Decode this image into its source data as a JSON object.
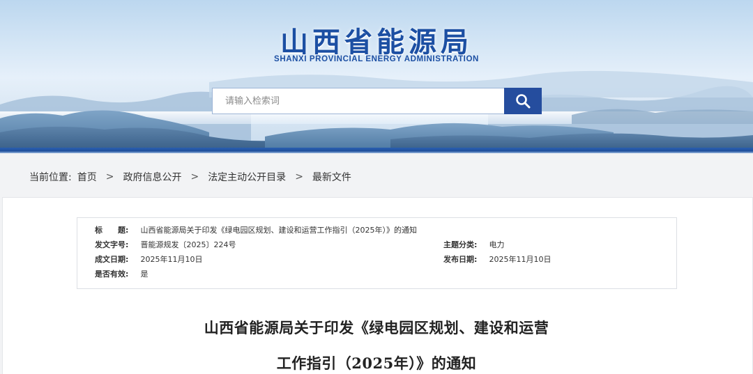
{
  "header": {
    "title_cn": "山西省能源局",
    "title_en": "SHANXI PROVINCIAL ENERGY ADMINISTRATION",
    "search_placeholder": "请输入检索词",
    "search_icon": "search-icon"
  },
  "colors": {
    "brand_blue": "#1c4fa3",
    "button_blue": "#254d9e",
    "page_bg": "#f2f3f5"
  },
  "breadcrumb": {
    "prefix": "当前位置:",
    "items": [
      "首页",
      "政府信息公开",
      "法定主动公开目录",
      "最新文件"
    ],
    "separator": ">"
  },
  "meta": {
    "title_label": "标　　题:",
    "title_value": "山西省能源局关于印发《绿电园区规划、建设和运营工作指引（2025年）》的通知",
    "doc_no_label": "发文字号:",
    "doc_no_value": "晋能源规发〔2025〕224号",
    "category_label": "主题分类:",
    "category_value": "电力",
    "created_label": "成文日期:",
    "created_value": "2025年11月10日",
    "published_label": "发布日期:",
    "published_value": "2025年11月10日",
    "valid_label": "是否有效:",
    "valid_value": "是"
  },
  "document": {
    "title_line1": "山西省能源局关于印发《绿电园区规划、建设和运营",
    "title_line2": "工作指引（2025年）》的通知"
  }
}
